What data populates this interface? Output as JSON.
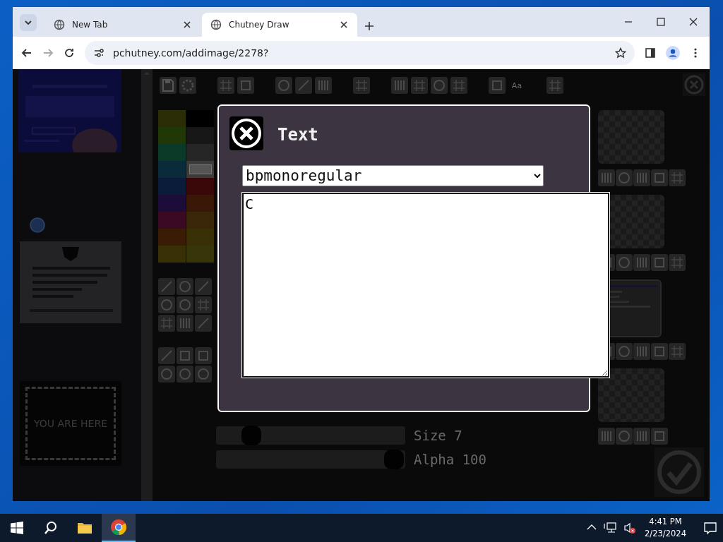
{
  "browser": {
    "tabs": [
      {
        "title": "New Tab",
        "selected": false
      },
      {
        "title": "Chutney Draw",
        "selected": true
      }
    ],
    "url": "pchutney.com/addimage/2278?"
  },
  "sidebar": {
    "badge": "YOU ARE HERE"
  },
  "toolbar": {
    "font_button": "Aa"
  },
  "palette": [
    {
      "color": "#2b2d06",
      "selected": false
    },
    {
      "color": "#000000",
      "selected": false
    },
    {
      "color": "#1f3806",
      "selected": false
    },
    {
      "color": "#171717",
      "selected": false
    },
    {
      "color": "#0a3a28",
      "selected": false
    },
    {
      "color": "#262626",
      "selected": false
    },
    {
      "color": "#0a2c3a",
      "selected": false
    },
    {
      "color": "#3c3c3c",
      "selected": true
    },
    {
      "color": "#0a1c3a",
      "selected": false
    },
    {
      "color": "#3a0808",
      "selected": false
    },
    {
      "color": "#1c0c3a",
      "selected": false
    },
    {
      "color": "#3a1808",
      "selected": false
    },
    {
      "color": "#3a0a22",
      "selected": false
    },
    {
      "color": "#3a2608",
      "selected": false
    },
    {
      "color": "#3a1c06",
      "selected": false
    },
    {
      "color": "#3a3006",
      "selected": false
    },
    {
      "color": "#3a3006",
      "selected": false
    },
    {
      "color": "#363608",
      "selected": false
    }
  ],
  "sliders": [
    {
      "label": "Size 7",
      "level": 0.15
    },
    {
      "label": "Alpha 100",
      "level": 1
    }
  ],
  "dialog": {
    "title": "Text",
    "font": "bpmonoregular",
    "text": "C"
  },
  "taskbar": {
    "time": "4:41 PM",
    "date": "2/23/2024"
  }
}
